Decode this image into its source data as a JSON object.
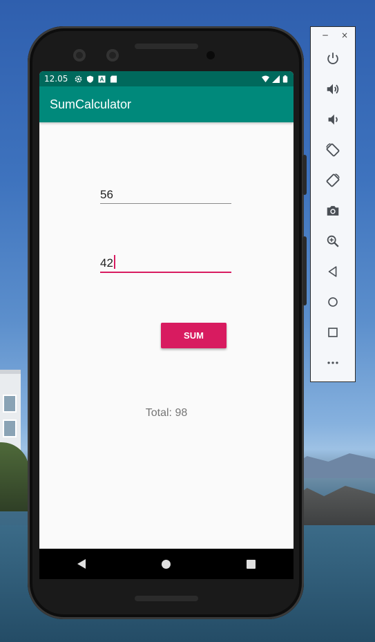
{
  "status_bar": {
    "time": "12.05",
    "left_icons": [
      "gear-icon",
      "shield-icon",
      "a-badge-icon",
      "sd-card-icon"
    ],
    "right_icons": [
      "wifi-icon",
      "signal-icon",
      "battery-icon"
    ]
  },
  "app": {
    "title": "SumCalculator",
    "first_number": "56",
    "second_number": "42",
    "sum_button_label": "SUM",
    "total_text": "Total: 98",
    "accent_color": "#d81b60",
    "primary_color": "#00897b",
    "primary_dark": "#00695c"
  },
  "nav_bar": [
    "back-icon",
    "home-icon",
    "recents-icon"
  ],
  "emulator_toolbar": {
    "window_controls": {
      "minimize": "−",
      "close": "×"
    },
    "items": [
      "power-icon",
      "volume-up-icon",
      "volume-down-icon",
      "rotate-left-icon",
      "rotate-right-icon",
      "camera-icon",
      "zoom-icon",
      "back-icon",
      "home-icon",
      "overview-icon",
      "more-icon"
    ]
  }
}
